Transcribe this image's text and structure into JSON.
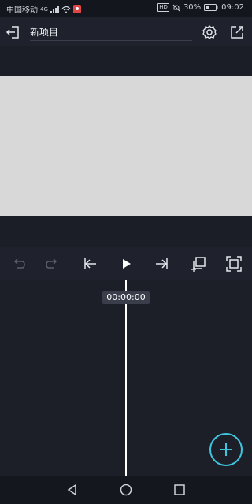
{
  "status_bar": {
    "carrier": "中国移动",
    "network": "4G",
    "hd": "HD",
    "battery": "30%",
    "time": "09:02"
  },
  "header": {
    "title": "新项目",
    "icons": {
      "back": "exit-icon",
      "settings": "gear-icon",
      "export": "share-icon"
    }
  },
  "controls": {
    "icons": [
      "undo-icon",
      "redo-icon",
      "skip-to-start-icon",
      "play-icon",
      "skip-to-end-icon",
      "add-layer-icon",
      "fullscreen-icon"
    ]
  },
  "timeline": {
    "timecode": "00:00:00"
  },
  "fab": {
    "icon": "plus-icon"
  },
  "nav": {
    "icons": [
      "back-triangle-icon",
      "home-circle-icon",
      "recents-square-icon"
    ]
  },
  "colors": {
    "accent": "#3fc6de",
    "background": "#1d1f2a",
    "preview": "#d8d8d8"
  }
}
